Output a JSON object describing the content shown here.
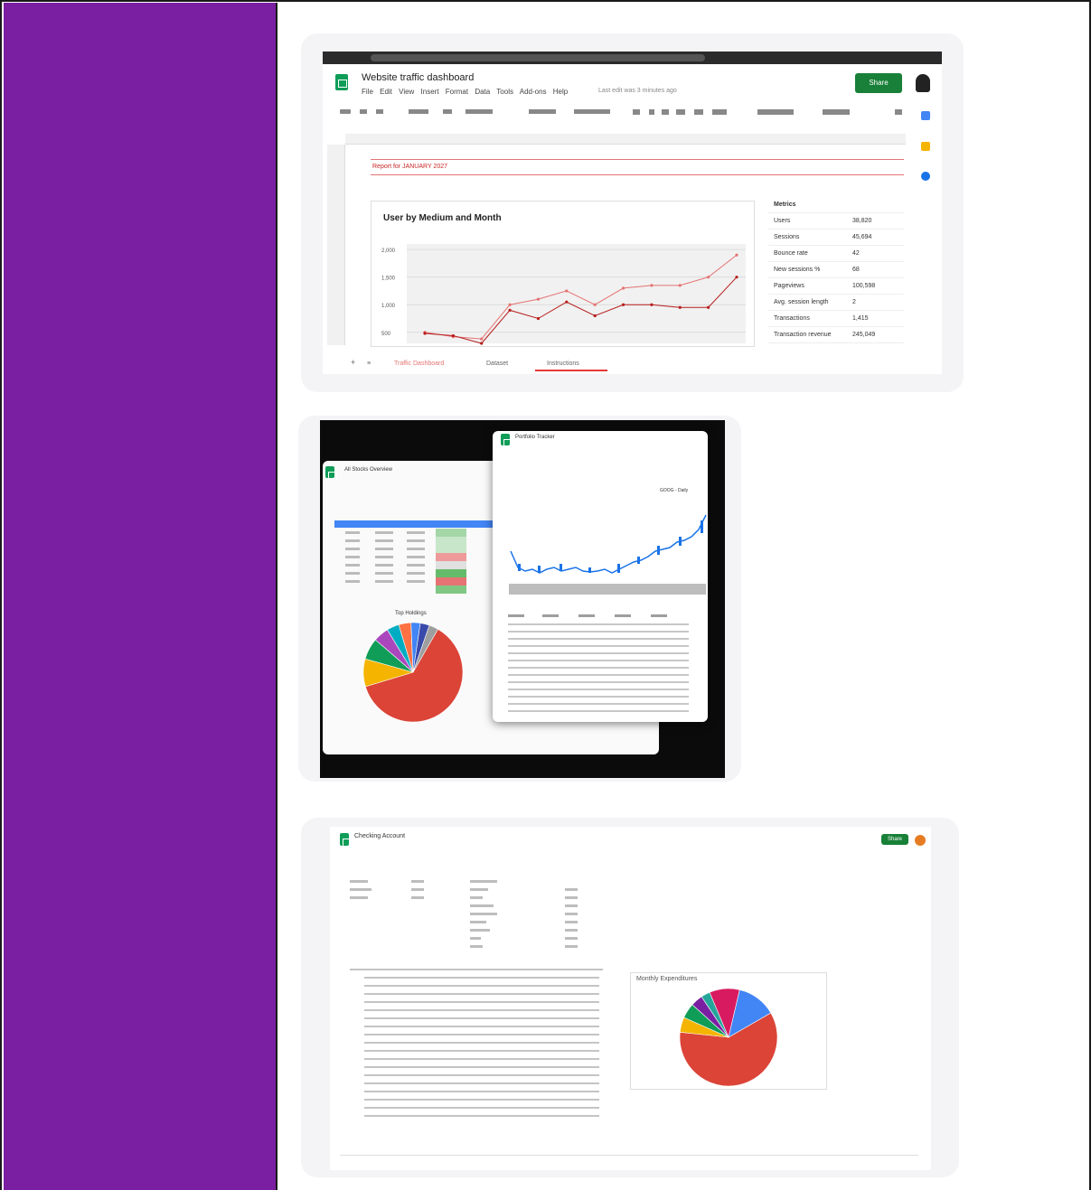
{
  "colors": {
    "sidebar": "#7b1fa2",
    "card_bg": "#f4f4f6",
    "sheets_green": "#0f9d58",
    "share_green": "#188038",
    "series_a": "#e57373",
    "series_b": "#b71c1c"
  },
  "screenshot1": {
    "doc_title": "Website traffic dashboard",
    "menu": "File Edit View Insert Format Data Tools Add-ons Help",
    "last_edit": "Last edit was 3 minutes ago",
    "share_label": "Share",
    "report_label": "Report for JANUARY 2027",
    "chart_title": "User by Medium and Month",
    "y_ticks": [
      "2,000",
      "1,500",
      "1,000",
      "500"
    ],
    "metrics_header": "Metrics",
    "metrics": [
      {
        "key": "Users",
        "value": "38,820"
      },
      {
        "key": "Sessions",
        "value": "45,694"
      },
      {
        "key": "Bounce rate",
        "value": "42"
      },
      {
        "key": "New sessions %",
        "value": "68"
      },
      {
        "key": "Pageviews",
        "value": "100,598"
      },
      {
        "key": "Avg. session length",
        "value": "2"
      },
      {
        "key": "Transactions",
        "value": "1,415"
      },
      {
        "key": "Transaction revenue",
        "value": "245,049"
      }
    ],
    "tabs": [
      "Traffic Dashboard",
      "Dataset",
      "Instructions"
    ],
    "chart_data": {
      "type": "line",
      "x": [
        1,
        2,
        3,
        4,
        5,
        6,
        7,
        8,
        9,
        10,
        11,
        12
      ],
      "series": [
        {
          "values": [
            500,
            420,
            380,
            1000,
            1100,
            1250,
            1000,
            1300,
            1350,
            1350,
            1500,
            1900
          ],
          "color": "#e57373"
        },
        {
          "values": [
            480,
            440,
            300,
            900,
            750,
            1050,
            800,
            1000,
            1000,
            950,
            950,
            1500
          ],
          "color": "#b71c1c"
        }
      ],
      "ylim": [
        300,
        2100
      ]
    }
  },
  "screenshot2": {
    "back_title": "All Stocks Overview",
    "front_title": "Portfolio Tracker",
    "pie_title": "Top Holdings",
    "chart_label": "GOOG - Daily",
    "chart_data": {
      "type": "pie",
      "values": [
        62,
        9,
        7,
        5,
        4,
        4,
        3,
        3,
        3
      ],
      "colors": [
        "#db4437",
        "#f4b400",
        "#0f9d58",
        "#ab47bc",
        "#00acc1",
        "#ff7043",
        "#4285f4",
        "#3949ab",
        "#9e9e9e"
      ]
    }
  },
  "screenshot3": {
    "doc_title": "Checking Account",
    "share_label": "Share",
    "chart_title": "Monthly Expenditures",
    "chart_data": {
      "type": "pie",
      "values": [
        60,
        5,
        5,
        4,
        3,
        10,
        13
      ],
      "colors": [
        "#db4437",
        "#f4b400",
        "#0f9d58",
        "#7b1fa2",
        "#26a69a",
        "#d81b60",
        "#4285f4"
      ]
    }
  }
}
